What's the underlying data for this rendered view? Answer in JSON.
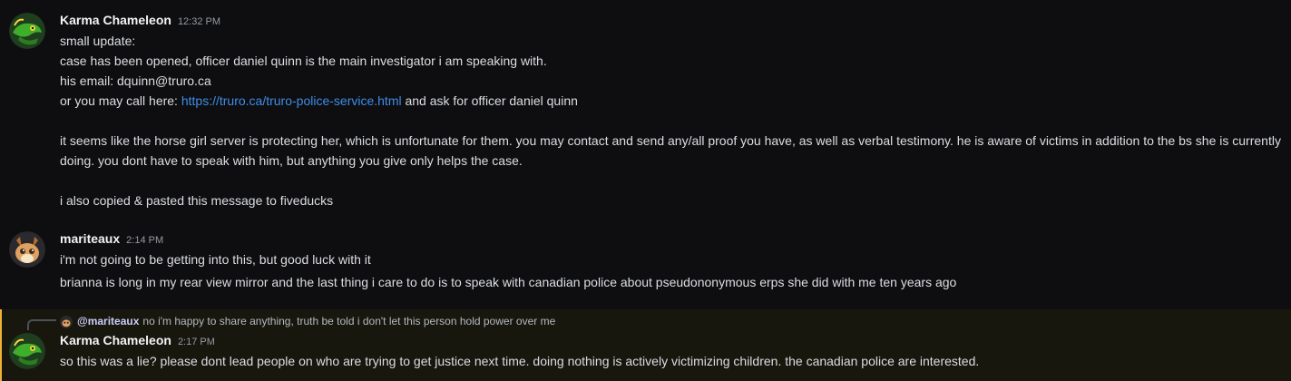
{
  "messages": [
    {
      "author": "Karma Chameleon",
      "time": "12:32 PM",
      "avatar_icon": "chameleon-avatar",
      "lines": [
        "small update:",
        "case has been opened, officer daniel quinn is the main investigator i am speaking with.",
        "his email: dquinn@truro.ca"
      ],
      "call_prefix": "or you may call here: ",
      "call_link": "https://truro.ca/truro-police-service.html",
      "call_suffix": " and ask for officer daniel quinn",
      "paragraph": "it seems like the horse girl server is protecting her, which is unfortunate for them. you may contact and send any/all proof you have, as well as verbal testimony. he is aware of victims in addition to the bs she is currently doing. you dont have to speak with him, but anything you give only helps the case.",
      "closing": "i also copied & pasted this message to fiveducks"
    },
    {
      "author": "mariteaux",
      "time": "2:14 PM",
      "avatar_icon": "fox-avatar",
      "lines": [
        "i'm not going to be getting into this, but good luck with it",
        "brianna is long in my rear view mirror and the last thing i care to do is to speak with canadian police about pseudononymous erps she did with me ten years ago"
      ]
    },
    {
      "reply_to": {
        "mention": "@mariteaux",
        "text": "no i'm happy to share anything, truth be told i don't let this person hold power over me",
        "avatar_icon": "fox-avatar"
      },
      "author": "Karma Chameleon",
      "time": "2:17 PM",
      "avatar_icon": "chameleon-avatar",
      "lines": [
        "so this was a lie? please dont lead people on who are trying to get justice next time. doing nothing is actively victimizing children. the canadian police are interested."
      ]
    }
  ],
  "colors": {
    "background": "#0e0e10",
    "link": "#3e8de8",
    "mention_highlight": "#18170e",
    "mention_bar": "#f0b232"
  }
}
